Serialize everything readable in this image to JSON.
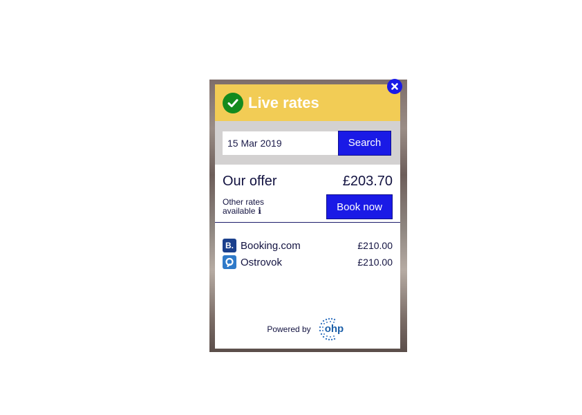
{
  "header": {
    "title": "Live rates"
  },
  "search": {
    "date_value": "15 Mar 2019",
    "button_label": "Search"
  },
  "offer": {
    "label": "Our offer",
    "price": "£203.70",
    "other_rates_line1": "Other rates",
    "other_rates_line2": "available",
    "info_glyph": "i",
    "book_label": "Book now"
  },
  "providers": [
    {
      "name": "Booking.com",
      "logo_text": "B.",
      "price": "£210.00"
    },
    {
      "name": "Ostrovok",
      "logo_text": "",
      "price": "£210.00"
    }
  ],
  "footer": {
    "powered_by": "Powered by",
    "brand": "ohp"
  },
  "colors": {
    "accent_blue": "#1a1ae6",
    "header_yellow": "#f2cc55",
    "check_green": "#138a1e"
  },
  "icons": [
    "check-icon",
    "close-icon",
    "info-icon",
    "booking-logo-icon",
    "ostrovok-logo-icon",
    "ohp-logo-icon"
  ]
}
